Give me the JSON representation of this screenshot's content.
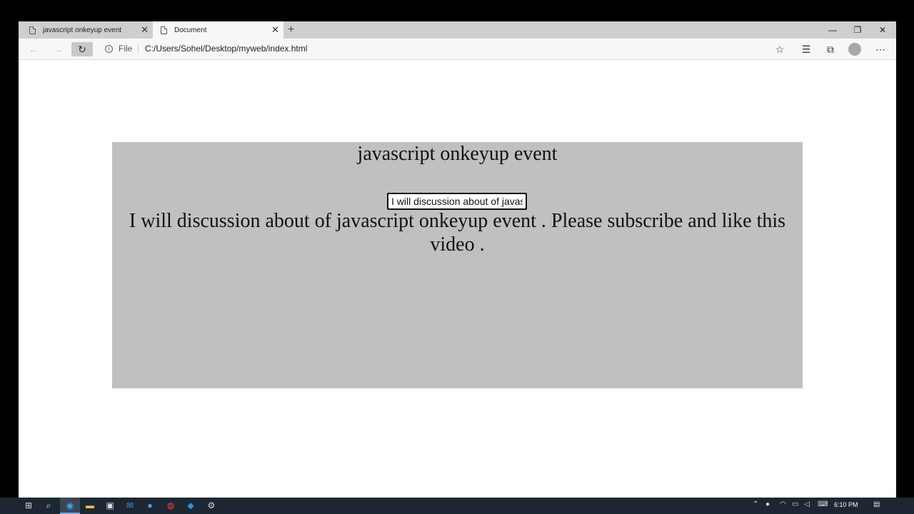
{
  "browser": {
    "tabs": [
      {
        "title": "javascript onkeyup event"
      },
      {
        "title": "Document"
      }
    ],
    "new_tab_icon": "+",
    "address": {
      "scheme_label": "File",
      "url": "C:/Users/Sohel/Desktop/myweb/index.html"
    }
  },
  "page": {
    "heading": "javascript onkeyup event",
    "input_value": "I will discussion about of javascript onkeyup event . Please subscribe and like this video .",
    "output_text": "I will discussion about of javascript onkeyup event . Please subscribe and like this video .",
    "box_color": "#c0c0c0"
  },
  "taskbar": {
    "clock": "6:10 PM"
  }
}
